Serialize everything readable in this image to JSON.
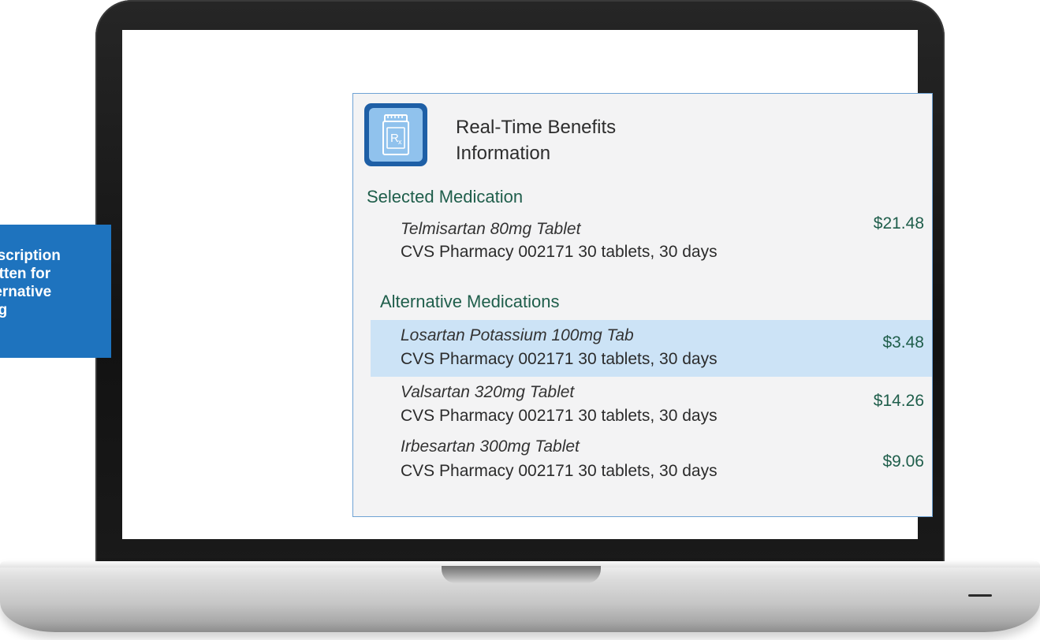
{
  "callout": {
    "text": "escription\nritten for\nternative\nug"
  },
  "panel": {
    "icon": "prescription-bottle-icon",
    "title": "Real-Time Benefits Information",
    "selected_heading": "Selected Medication",
    "alternatives_heading": "Alternative Medications",
    "selected": {
      "name": "Telmisartan 80mg Tablet",
      "detail": "CVS Pharmacy 002171 30 tablets, 30 days",
      "price": "$21.48"
    },
    "alternatives": [
      {
        "name": "Losartan Potassium 100mg Tab",
        "detail": "CVS Pharmacy 002171 30 tablets, 30 days",
        "price": "$3.48",
        "highlighted": true
      },
      {
        "name": "Valsartan 320mg Tablet",
        "detail": "CVS Pharmacy 002171 30 tablets, 30 days",
        "price": "$14.26",
        "highlighted": false
      },
      {
        "name": "Irbesartan 300mg Tablet",
        "detail": "CVS Pharmacy 002171 30 tablets, 30 days",
        "price": "$9.06",
        "highlighted": false
      }
    ]
  },
  "colors": {
    "accent_blue": "#1e73be",
    "heading_green": "#1f5e4b",
    "highlight_row": "#cce3f6",
    "panel_border": "#6fa3d4"
  }
}
